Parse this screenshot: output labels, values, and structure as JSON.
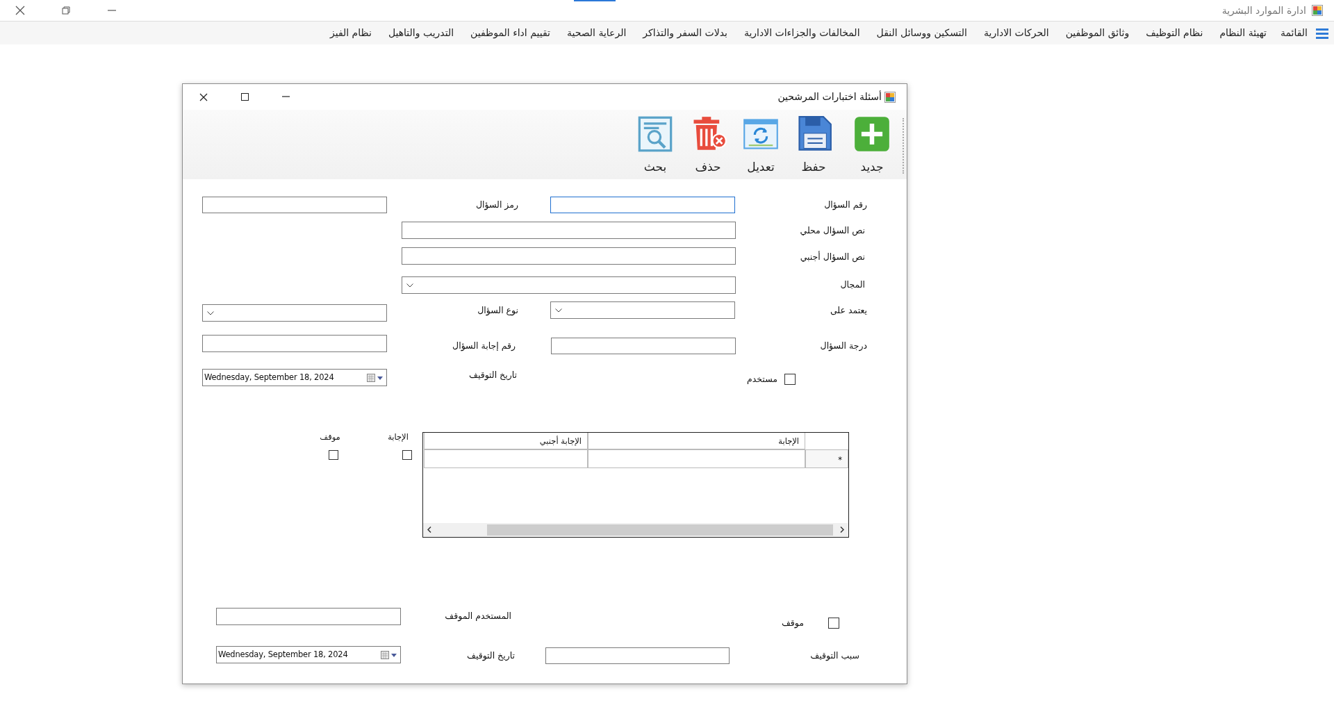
{
  "app": {
    "title": "ادارة الموارد البشرية"
  },
  "menu": [
    "القائمة",
    "تهيئة النظام",
    "نظام التوظيف",
    "وثائق الموظفين",
    "الحركات الادارية",
    "التسكين ووسائل النقل",
    "المخالفات والجزاءات الادارية",
    "بدلات السفر والتذاكر",
    "الرعاية الصحية",
    "تقييم اداء الموظفين",
    "التدريب والتاهيل",
    "نظام الفيز"
  ],
  "dialog": {
    "title": "أسئلة اختبارات المرشحين",
    "toolbar": [
      {
        "kind": "new",
        "label": "جديد"
      },
      {
        "kind": "save",
        "label": "حفظ"
      },
      {
        "kind": "edit",
        "label": "تعديل"
      },
      {
        "kind": "delete",
        "label": "حذف"
      },
      {
        "kind": "search",
        "label": "بحث"
      }
    ],
    "fields": [
      {
        "kind": "text",
        "label": "رقم السؤال",
        "focused": true
      },
      {
        "kind": "text",
        "label": "رمز السؤال",
        "focused": false
      },
      {
        "kind": "text",
        "label": "نص السؤال محلي",
        "focused": false
      },
      {
        "kind": "text",
        "label": "نص السؤال أجنبي",
        "focused": false
      },
      {
        "kind": "combo",
        "label": "المجال"
      },
      {
        "kind": "combo",
        "label": "يعتمد على"
      },
      {
        "kind": "combo",
        "label": "نوع السؤال"
      },
      {
        "kind": "text",
        "label": "درجة السؤال",
        "focused": false
      },
      {
        "kind": "text",
        "label": "رقم إجابة السؤال",
        "focused": false
      },
      {
        "kind": "checkbox",
        "label": "مستخدم",
        "checked": false
      },
      {
        "kind": "date",
        "label": "تاريخ التوقيف",
        "value": "Wednesday, September 18, 2024"
      },
      {
        "kind": "checkbox",
        "label": "موقف",
        "checked": false
      },
      {
        "kind": "text",
        "label": "المستخدم الموقف",
        "focused": false
      },
      {
        "kind": "text",
        "label": "سبب التوقيف",
        "focused": false
      },
      {
        "kind": "date",
        "label": "تاريخ التوقيف",
        "value": "Wednesday, September 18, 2024"
      }
    ],
    "grid": {
      "columns": [
        "الإجابة",
        "الإجابة أجنبي"
      ],
      "new_row_marker": "*"
    },
    "grid_checks": [
      {
        "label": "الإجابة",
        "checked": false
      },
      {
        "label": "موقف",
        "checked": false
      }
    ]
  }
}
